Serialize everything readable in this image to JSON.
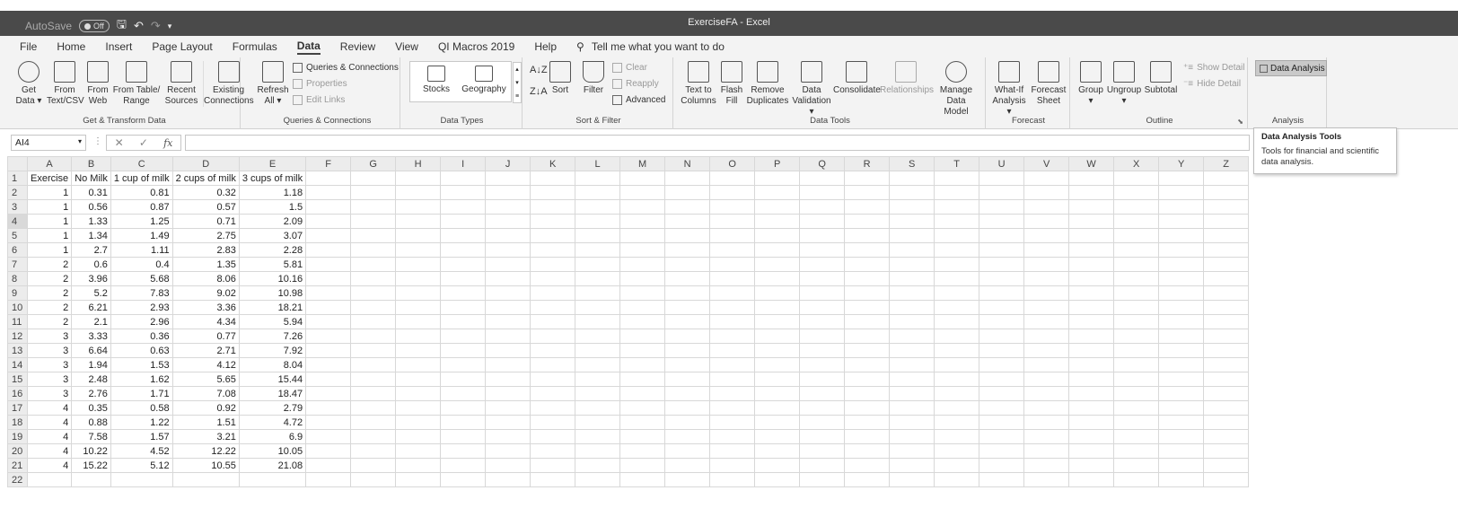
{
  "window": {
    "title": "ExerciseFA  -  Excel",
    "autosave_label": "AutoSave",
    "autosave_state": "Off",
    "qat": {
      "save_icon": "save-icon",
      "undo_icon": "undo-icon",
      "redo_icon": "redo-icon",
      "customize_icon": "customize-icon"
    }
  },
  "menu": {
    "tabs": [
      "File",
      "Home",
      "Insert",
      "Page Layout",
      "Formulas",
      "Data",
      "Review",
      "View",
      "QI Macros 2019",
      "Help"
    ],
    "active_tab": "Data",
    "tell_me": "Tell me what you want to do"
  },
  "ribbon": {
    "get_transform": {
      "label": "Get & Transform Data",
      "buttons": [
        "Get Data",
        "From Text/CSV",
        "From Web",
        "From Table/ Range",
        "Recent Sources",
        "Existing Connections"
      ]
    },
    "queries": {
      "label": "Queries & Connections",
      "refresh": "Refresh All",
      "queries_connections": "Queries & Connections",
      "properties": "Properties",
      "edit_links": "Edit Links"
    },
    "data_types": {
      "label": "Data Types",
      "stocks": "Stocks",
      "geography": "Geography"
    },
    "sort_filter": {
      "label": "Sort & Filter",
      "sort": "Sort",
      "filter": "Filter",
      "clear": "Clear",
      "reapply": "Reapply",
      "advanced": "Advanced"
    },
    "data_tools": {
      "label": "Data Tools",
      "buttons": [
        "Text to Columns",
        "Flash Fill",
        "Remove Duplicates",
        "Data Validation",
        "Consolidate",
        "Relationships",
        "Manage Data Model"
      ]
    },
    "forecast": {
      "label": "Forecast",
      "what_if": "What-If Analysis",
      "forecast_sheet": "Forecast Sheet"
    },
    "outline": {
      "label": "Outline",
      "group": "Group",
      "ungroup": "Ungroup",
      "subtotal": "Subtotal",
      "show_detail": "Show Detail",
      "hide_detail": "Hide Detail"
    },
    "analysis": {
      "label": "Analysis",
      "data_analysis": "Data Analysis"
    }
  },
  "formula_bar": {
    "name_box": "AI4",
    "cancel": "✕",
    "enter": "✓",
    "fx": "fx",
    "value": ""
  },
  "tooltip": {
    "title": "Data Analysis Tools",
    "body": "Tools for financial and scientific data analysis."
  },
  "sheet": {
    "columns": [
      "A",
      "B",
      "C",
      "D",
      "E",
      "F",
      "G",
      "H",
      "I",
      "J",
      "K",
      "L",
      "M",
      "N",
      "O",
      "P",
      "Q",
      "R",
      "S",
      "T",
      "U",
      "V",
      "W",
      "X",
      "Y",
      "Z"
    ],
    "header_row": [
      "Exercise",
      "No Milk",
      "1 cup of milk",
      "2 cups of milk",
      "3 cups of milk"
    ],
    "rows": [
      [
        "1",
        "0.31",
        "0.81",
        "0.32",
        "1.18"
      ],
      [
        "1",
        "0.56",
        "0.87",
        "0.57",
        "1.5"
      ],
      [
        "1",
        "1.33",
        "1.25",
        "0.71",
        "2.09"
      ],
      [
        "1",
        "1.34",
        "1.49",
        "2.75",
        "3.07"
      ],
      [
        "1",
        "2.7",
        "1.11",
        "2.83",
        "2.28"
      ],
      [
        "2",
        "0.6",
        "0.4",
        "1.35",
        "5.81"
      ],
      [
        "2",
        "3.96",
        "5.68",
        "8.06",
        "10.16"
      ],
      [
        "2",
        "5.2",
        "7.83",
        "9.02",
        "10.98"
      ],
      [
        "2",
        "6.21",
        "2.93",
        "3.36",
        "18.21"
      ],
      [
        "2",
        "2.1",
        "2.96",
        "4.34",
        "5.94"
      ],
      [
        "3",
        "3.33",
        "0.36",
        "0.77",
        "7.26"
      ],
      [
        "3",
        "6.64",
        "0.63",
        "2.71",
        "7.92"
      ],
      [
        "3",
        "1.94",
        "1.53",
        "4.12",
        "8.04"
      ],
      [
        "3",
        "2.48",
        "1.62",
        "5.65",
        "15.44"
      ],
      [
        "3",
        "2.76",
        "1.71",
        "7.08",
        "18.47"
      ],
      [
        "4",
        "0.35",
        "0.58",
        "0.92",
        "2.79"
      ],
      [
        "4",
        "0.88",
        "1.22",
        "1.51",
        "4.72"
      ],
      [
        "4",
        "7.58",
        "1.57",
        "3.21",
        "6.9"
      ],
      [
        "4",
        "10.22",
        "4.52",
        "12.22",
        "10.05"
      ],
      [
        "4",
        "15.22",
        "5.12",
        "10.55",
        "21.08"
      ]
    ],
    "row_numbers": [
      "1",
      "2",
      "3",
      "4",
      "5",
      "6",
      "7",
      "8",
      "9",
      "10",
      "11",
      "12",
      "13",
      "14",
      "15",
      "16",
      "17",
      "18",
      "19",
      "20",
      "21",
      "22"
    ]
  }
}
